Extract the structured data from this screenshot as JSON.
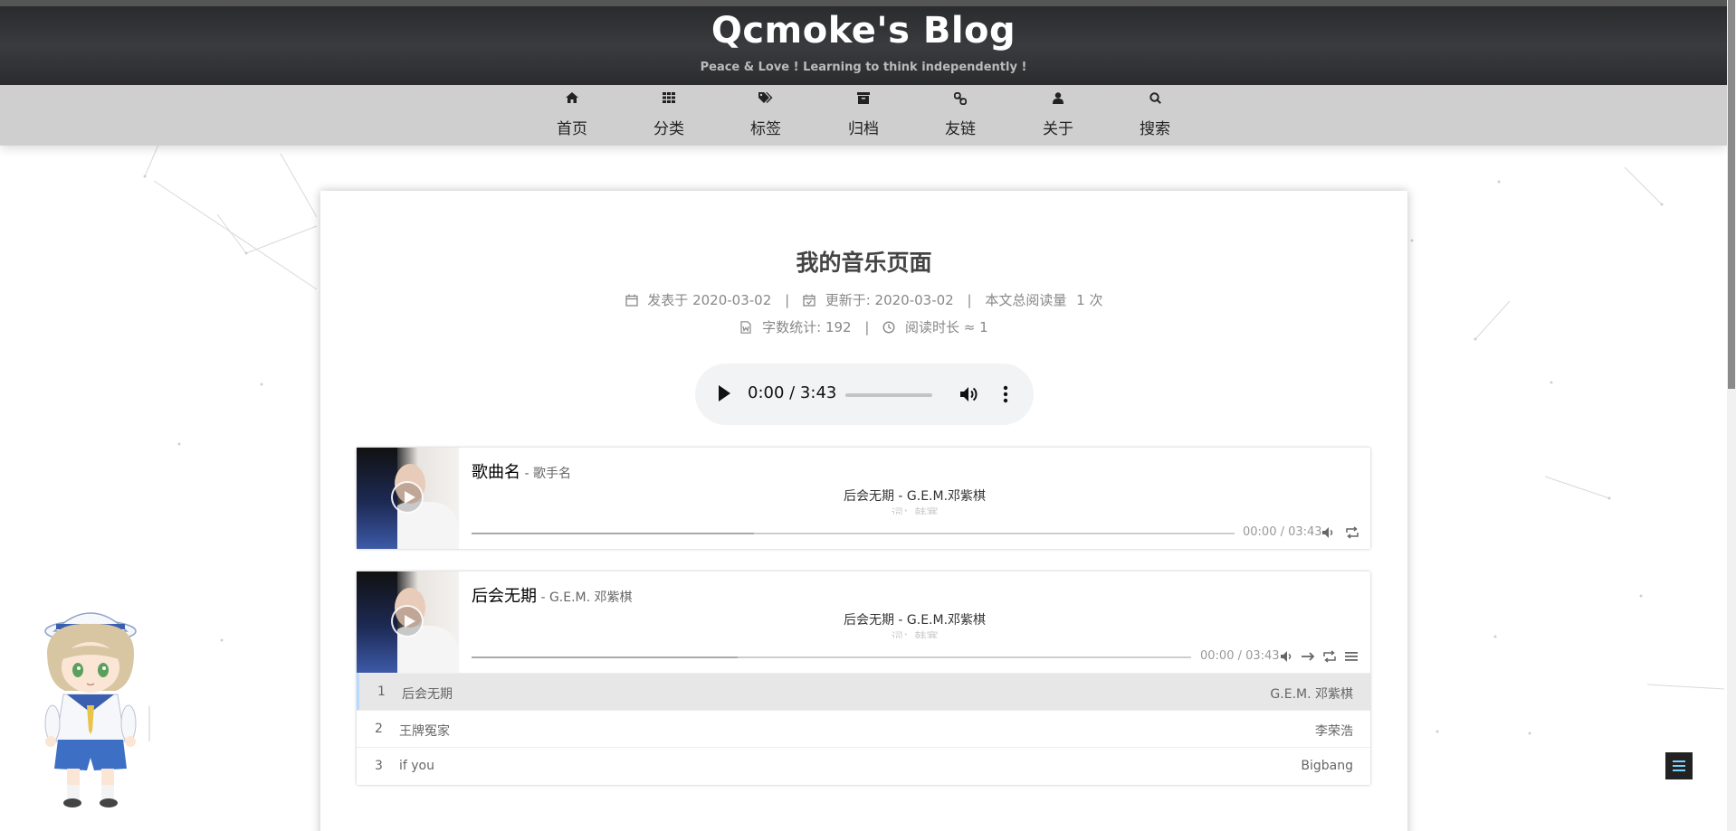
{
  "site": {
    "title": "Qcmoke's Blog",
    "subtitle": "Peace & Love ! Learning to think independently !"
  },
  "nav": {
    "items": [
      {
        "label": "首页",
        "icon": "home-icon"
      },
      {
        "label": "分类",
        "icon": "grid-icon"
      },
      {
        "label": "标签",
        "icon": "tags-icon"
      },
      {
        "label": "归档",
        "icon": "archive-icon"
      },
      {
        "label": "友链",
        "icon": "link-icon"
      },
      {
        "label": "关于",
        "icon": "user-icon"
      },
      {
        "label": "搜索",
        "icon": "search-icon"
      }
    ]
  },
  "post": {
    "title": "我的音乐页面",
    "published_label": "发表于",
    "published_date": "2020-03-02",
    "updated_label": "更新于:",
    "updated_date": "2020-03-02",
    "views_label": "本文总阅读量",
    "views_count": "1",
    "views_unit": "次",
    "wordcount_label": "字数统计:",
    "wordcount": "192",
    "readtime_label": "阅读时长 ≈",
    "readtime": "1"
  },
  "audio": {
    "time": "0:00 / 3:43"
  },
  "player1": {
    "title": "歌曲名",
    "author": " - 歌手名",
    "lrc_current": "后会无期 - G.E.M.邓紫棋",
    "lrc_next": "词：韩寒",
    "time": "00:00 / 03:43",
    "loaded_fraction": 0.37
  },
  "player2": {
    "title": "后会无期",
    "author": " - G.E.M. 邓紫棋",
    "lrc_current": "后会无期 - G.E.M.邓紫棋",
    "lrc_next": "词：韩寒",
    "time": "00:00 / 03:43",
    "loaded_fraction": 0.37,
    "playlist": [
      {
        "index": "1",
        "name": "后会无期",
        "artist": "G.E.M. 邓紫棋",
        "active": true
      },
      {
        "index": "2",
        "name": "王牌冤家",
        "artist": "李荣浩",
        "active": false
      },
      {
        "index": "3",
        "name": "if you",
        "artist": "Bigbang",
        "active": false
      }
    ]
  }
}
